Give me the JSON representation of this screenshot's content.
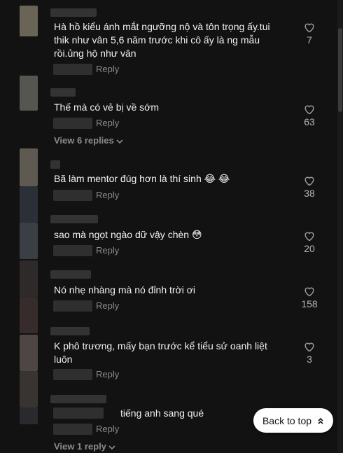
{
  "comments": [
    {
      "text": "Hà hồ kiểu ánh mắt ngưỡng nộ và tôn trọng ấy.tui thik như vân 5,6 năm trước khi cô ấy là ng mẫu rồi.ủng hộ như vân",
      "reply_label": "Reply",
      "likes": "7"
    },
    {
      "text": "Thế mà có vẻ bị về sớm",
      "reply_label": "Reply",
      "likes": "63",
      "view_replies": "View 6 replies"
    },
    {
      "text": "Bã làm mentor đúg hơn là thí sinh 😂 😂",
      "reply_label": "Reply",
      "likes": "38"
    },
    {
      "text": "sao mà ngọt ngào dữ vậy chèn 😳",
      "reply_label": "Reply",
      "likes": "20"
    },
    {
      "text": "Nó nhẹ nhàng mà nó đỉnh trời ơi",
      "reply_label": "Reply",
      "likes": "158"
    },
    {
      "text": "K phô trương, mấy bạn trước kể tiểu sử oanh liệt luôn",
      "reply_label": "Reply",
      "likes": "3"
    },
    {
      "text": "tiếng anh sang qué",
      "reply_label": "Reply",
      "view_replies": "View 1 reply"
    }
  ],
  "back_to_top": "Back to top",
  "icons": {
    "like": "heart-outline-icon",
    "chevron": "chevron-down-icon",
    "back_to_top": "double-chevron-up-icon"
  }
}
